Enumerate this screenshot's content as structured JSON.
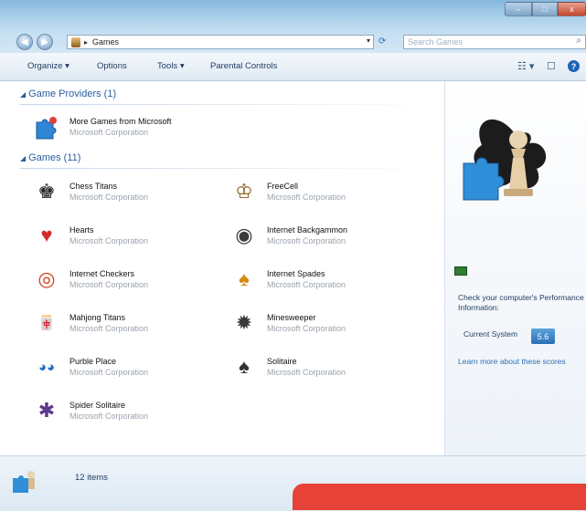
{
  "window": {
    "minimize_label": "–",
    "maximize_label": "□",
    "close_label": "x"
  },
  "nav": {
    "back_label": "◀",
    "forward_label": "▶",
    "breadcrumb": "Games",
    "search_placeholder": "Search Games",
    "icons": [
      "back-icon",
      "forward-icon",
      "refresh-icon",
      "search-icon"
    ]
  },
  "toolbar": {
    "organize": "Organize ▾",
    "options": "Options",
    "tools": "Tools ▾",
    "parental": "Parental Controls",
    "view_icon": "☷ ▾",
    "pane_icon": "☐",
    "help_icon": "?"
  },
  "sections": {
    "providers": "Game Providers (1)",
    "games": "Games (11)"
  },
  "providers": [
    {
      "name": "More Games from Microsoft",
      "publisher": "Microsoft Corporation",
      "icon": "puzzle-icon"
    }
  ],
  "games": [
    {
      "name": "Chess Titans",
      "publisher": "Microsoft Corporation",
      "icon": "chess-icon",
      "glyph": "♚",
      "color": "#2b2b2b"
    },
    {
      "name": "FreeCell",
      "publisher": "Microsoft Corporation",
      "icon": "freecell-icon",
      "glyph": "♔",
      "color": "#8b5a14"
    },
    {
      "name": "Hearts",
      "publisher": "Microsoft Corporation",
      "icon": "hearts-icon",
      "glyph": "♥",
      "color": "#d42b2b"
    },
    {
      "name": "Internet Backgammon",
      "publisher": "Microsoft Corporation",
      "icon": "backgammon-icon",
      "glyph": "◉",
      "color": "#3a3a3a"
    },
    {
      "name": "Internet Checkers",
      "publisher": "Microsoft Corporation",
      "icon": "checkers-icon",
      "glyph": "◎",
      "color": "#d4401c"
    },
    {
      "name": "Internet Spades",
      "publisher": "Microsoft Corporation",
      "icon": "spades-icon",
      "glyph": "♠",
      "color": "#d48a14"
    },
    {
      "name": "Mahjong Titans",
      "publisher": "Microsoft Corporation",
      "icon": "mahjong-icon",
      "glyph": "🀄",
      "color": "#b0362c"
    },
    {
      "name": "Minesweeper",
      "publisher": "Microsoft Corporation",
      "icon": "minesweeper-icon",
      "glyph": "✹",
      "color": "#3a3a3a"
    },
    {
      "name": "Purble Place",
      "publisher": "Microsoft Corporation",
      "icon": "purble-icon",
      "glyph": "◕◕",
      "color": "#2470c2"
    },
    {
      "name": "Solitaire",
      "publisher": "Microsoft Corporation",
      "icon": "solitaire-icon",
      "glyph": "♠",
      "color": "#333333"
    },
    {
      "name": "Spider Solitaire",
      "publisher": "Microsoft Corporation",
      "icon": "spider-icon",
      "glyph": "✱",
      "color": "#5a3a8a"
    }
  ],
  "preview": {
    "perf_text": "Check your computer's Performance Information:",
    "current_system": "Current System",
    "score": "5.6",
    "learn_more": "Learn more about these scores"
  },
  "status": {
    "count": "12 items"
  },
  "colors": {
    "accent": "#2a5fa0",
    "banner": "#e64238"
  }
}
